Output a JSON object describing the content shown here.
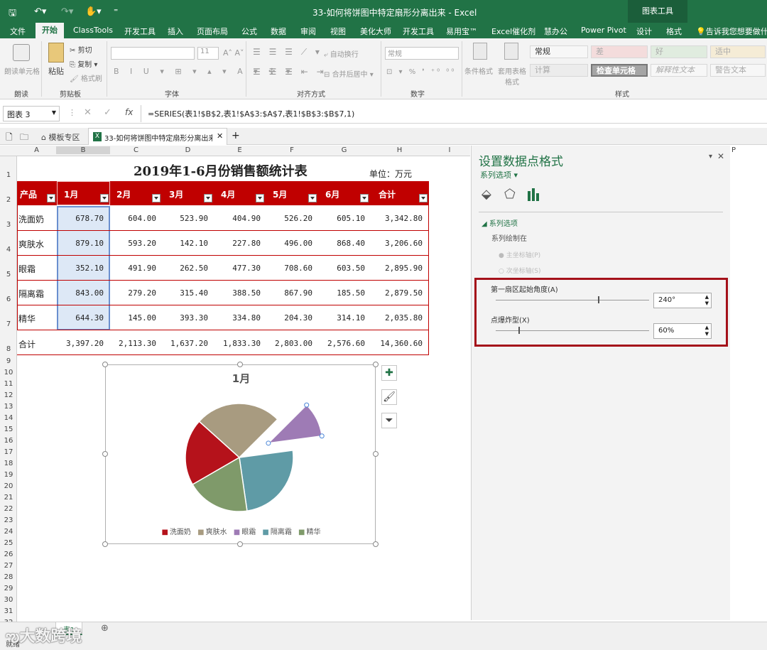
{
  "window": {
    "title": "33-如何将饼图中特定扇形分离出来 - Excel",
    "context_tools": "图表工具"
  },
  "ribbon_tabs": [
    {
      "label": "文件"
    },
    {
      "label": "开始"
    },
    {
      "label": "ClassTools"
    },
    {
      "label": "开发工具"
    },
    {
      "label": "插入"
    },
    {
      "label": "页面布局"
    },
    {
      "label": "公式"
    },
    {
      "label": "数据"
    },
    {
      "label": "审阅"
    },
    {
      "label": "视图"
    },
    {
      "label": "美化大师"
    },
    {
      "label": "开发工具"
    },
    {
      "label": "易用宝™"
    },
    {
      "label": "Excel催化剂"
    },
    {
      "label": "慧办公"
    },
    {
      "label": "Power Pivot"
    },
    {
      "label": "设计"
    },
    {
      "label": "格式"
    }
  ],
  "tell_me": "告诉我您想要做什么",
  "ribbon": {
    "readout": "朗读单元格",
    "paste": "粘贴",
    "cut": "剪切",
    "copy": "复制",
    "format_painter": "格式刷",
    "font_size": "11",
    "wrap_text": "自动换行",
    "merge_center": "合并后居中",
    "number_format": "常规",
    "cond_format": "条件格式",
    "table_format": "套用表格格式",
    "groups": {
      "read": "朗读",
      "clipboard": "剪贴板",
      "font": "字体",
      "align": "对齐方式",
      "number": "数字",
      "styles": "样式"
    },
    "styles": {
      "normal": "常规",
      "bad": "差",
      "good": "好",
      "neutral": "适中",
      "calc": "计算",
      "check": "检查单元格",
      "explain": "解释性文本",
      "warn": "警告文本"
    }
  },
  "formula_bar": {
    "name_box": "图表 3",
    "formula": "=SERIES(表1!$B$2,表1!$A$3:$A$7,表1!$B$3:$B$7,1)"
  },
  "doc_tabs": [
    {
      "label": "模板专区"
    },
    {
      "label": "33-如何将饼图中特定扇形分离出来"
    }
  ],
  "columns": [
    "A",
    "B",
    "C",
    "D",
    "E",
    "F",
    "G",
    "H",
    "I",
    "P"
  ],
  "rows": [
    "1",
    "2",
    "3",
    "4",
    "5",
    "6",
    "7",
    "8",
    "9",
    "10",
    "11",
    "12",
    "13",
    "14",
    "15",
    "16",
    "17",
    "18",
    "19",
    "20",
    "21",
    "22",
    "23",
    "24",
    "25",
    "26",
    "27",
    "28",
    "29",
    "30",
    "31",
    "32"
  ],
  "sheet": {
    "title": "2019年1-6月份销售额统计表",
    "unit": "单位：万元",
    "headers": [
      "产品",
      "1月",
      "2月",
      "3月",
      "4月",
      "5月",
      "6月",
      "合计"
    ],
    "rows": [
      {
        "product": "洗面奶",
        "values": [
          "678.70",
          "604.00",
          "523.90",
          "404.90",
          "526.20",
          "605.10",
          "3,342.80"
        ]
      },
      {
        "product": "爽肤水",
        "values": [
          "879.10",
          "593.20",
          "142.10",
          "227.80",
          "496.00",
          "868.40",
          "3,206.60"
        ]
      },
      {
        "product": "眼霜",
        "values": [
          "352.10",
          "491.90",
          "262.50",
          "477.30",
          "708.60",
          "603.50",
          "2,895.90"
        ]
      },
      {
        "product": "隔离霜",
        "values": [
          "843.00",
          "279.20",
          "315.40",
          "388.50",
          "867.90",
          "185.50",
          "2,879.50"
        ]
      },
      {
        "product": "精华",
        "values": [
          "644.30",
          "145.00",
          "393.30",
          "334.80",
          "204.30",
          "314.10",
          "2,035.80"
        ]
      }
    ],
    "total": {
      "label": "合计",
      "values": [
        "3,397.20",
        "2,113.30",
        "1,637.20",
        "1,833.30",
        "2,803.00",
        "2,576.60",
        "14,360.60"
      ]
    }
  },
  "chart_data": {
    "type": "pie",
    "title": "1月",
    "categories": [
      "洗面奶",
      "爽肤水",
      "眼霜",
      "隔离霜",
      "精华"
    ],
    "values": [
      678.7,
      879.1,
      352.1,
      843.0,
      644.3
    ],
    "colors": [
      "#b5121b",
      "#a89b80",
      "#9e7bb5",
      "#5f9ba6",
      "#7f9a6a"
    ],
    "first_slice_angle_deg": 240,
    "exploded_category": "眼霜",
    "legend": "bottom"
  },
  "pane": {
    "title": "设置数据点格式",
    "subtitle": "系列选项",
    "section": "系列选项",
    "plot_on": "系列绘制在",
    "primary_axis": "主坐标轴(P)",
    "secondary_axis": "次坐标轴(S)",
    "angle_label": "第一扇区起始角度(A)",
    "angle_value": "240°",
    "angle_fraction": 0.667,
    "explosion_label": "点爆炸型(X)",
    "explosion_value": "60%",
    "explosion_fraction": 0.15,
    "highlight_color": "#a4111a"
  },
  "sheet_tab": "表1",
  "status": "就绪",
  "watermark": "大数跨境"
}
